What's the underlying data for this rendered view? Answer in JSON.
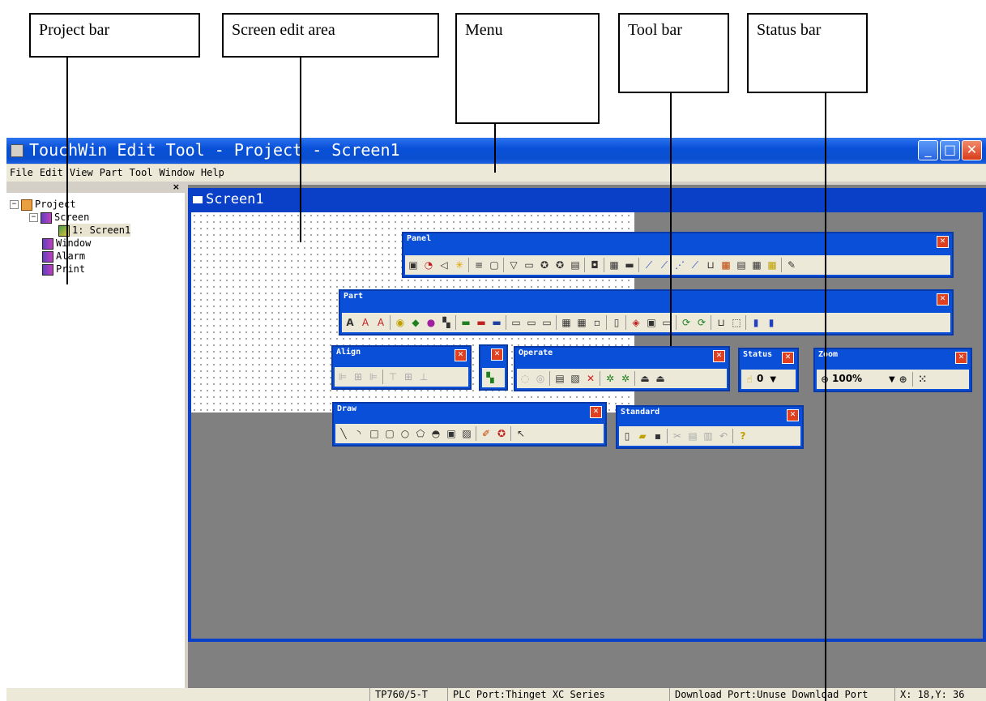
{
  "callouts": {
    "project_bar": "Project bar",
    "screen_edit_area": "Screen edit area",
    "menu": "Menu",
    "tool_bar": "Tool bar",
    "status_bar": "Status bar"
  },
  "window": {
    "title": "TouchWin Edit Tool - Project - Screen1",
    "min_label": "_",
    "max_label": "□",
    "close_label": "✕"
  },
  "menu": [
    "File",
    "Edit",
    "View",
    "Part",
    "Tool",
    "Window",
    "Help"
  ],
  "project_panel": {
    "close_label": "×",
    "tree": [
      "Project",
      "Screen",
      "1: Screen1",
      "Window",
      "Alarm",
      "Print"
    ]
  },
  "child_window": {
    "title": "Screen1"
  },
  "toolbars": {
    "panel": "Panel",
    "part": "Part",
    "align": "Align",
    "operate": "Operate",
    "status": "Status",
    "status_value": "0",
    "zoom": "Zoom",
    "zoom_value": "100%",
    "draw": "Draw",
    "standard": "Standard",
    "close_glyph": "✕"
  },
  "statusbar": {
    "model": "TP760/5-T",
    "plc_port": "PLC Port:Thinget XC Series",
    "download_port": "Download Port:Unuse Download Port",
    "coords": "X:  18,Y: 36"
  }
}
